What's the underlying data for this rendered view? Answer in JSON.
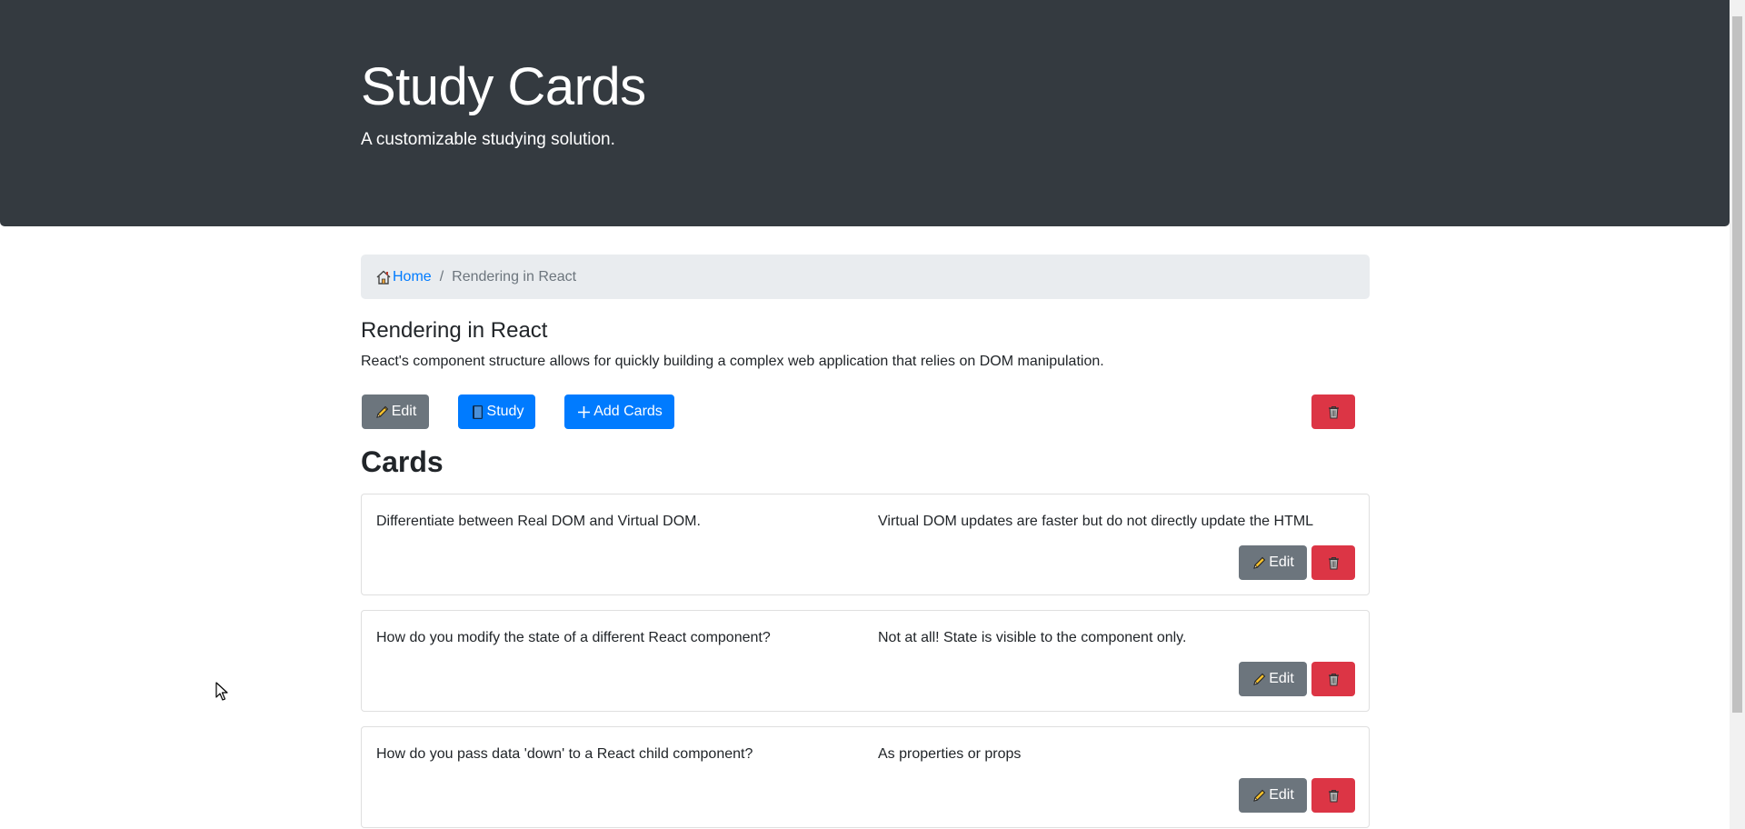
{
  "header": {
    "title": "Study Cards",
    "subtitle": "A customizable studying solution."
  },
  "breadcrumb": {
    "home_label": "Home",
    "separator": "/",
    "current": "Rendering in React"
  },
  "deck": {
    "name": "Rendering in React",
    "description": "React's component structure allows for quickly building a complex web application that relies on DOM manipulation.",
    "actions": {
      "edit_label": "Edit",
      "study_label": "Study",
      "add_cards_label": "Add Cards"
    }
  },
  "cards_section": {
    "heading": "Cards",
    "edit_label": "Edit",
    "cards": [
      {
        "front": "Differentiate between Real DOM and Virtual DOM.",
        "back": "Virtual DOM updates are faster but do not directly update the HTML"
      },
      {
        "front": "How do you modify the state of a different React component?",
        "back": "Not at all! State is visible to the component only."
      },
      {
        "front": "How do you pass data 'down' to a React child component?",
        "back": "As properties or props"
      }
    ]
  },
  "icons": {
    "home": "home-icon",
    "edit": "pencil-icon",
    "study": "book-icon",
    "add": "plus-icon",
    "delete": "trash-icon"
  },
  "colors": {
    "jumbotron_bg": "#343a40",
    "primary": "#007bff",
    "secondary": "#6c757d",
    "danger": "#dc3545",
    "breadcrumb_bg": "#e9ecef"
  }
}
